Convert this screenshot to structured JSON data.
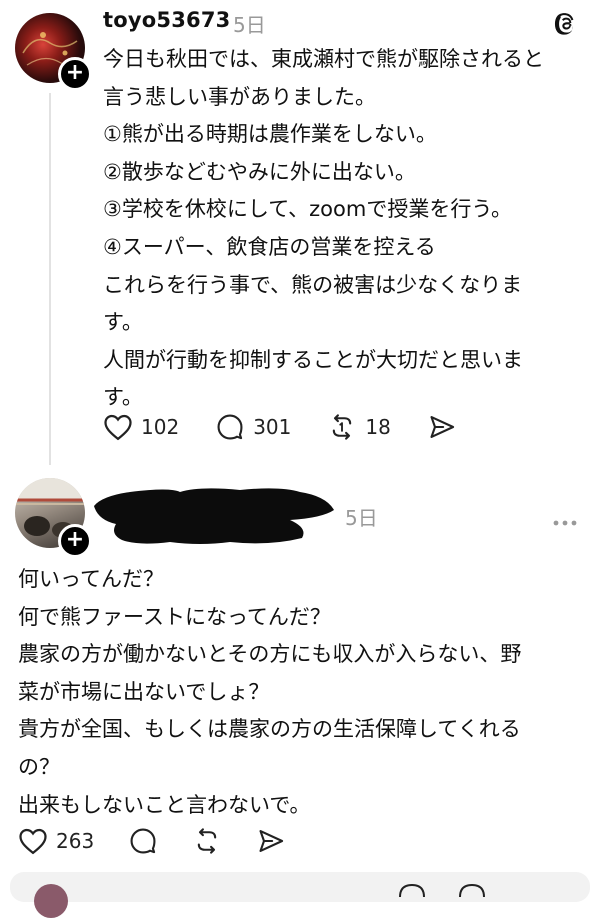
{
  "post1": {
    "username": "toyo53673",
    "time": "5日",
    "body": "今日も秋田では、東成瀬村で熊が駆除されると\n言う悲しい事がありました。\n①熊が出る時期は農作業をしない。\n②散歩などむやみに外に出ない。\n③学校を休校にして、zoomで授業を行う。\n④スーパー、飲食店の営業を控える\nこれらを行う事で、熊の被害は少なくなりま\nす。\n人間が行動を抑制することが大切だと思いま\nす。",
    "likes": "102",
    "replies": "301",
    "reposts": "18"
  },
  "post2": {
    "time": "5日",
    "body": "何いってんだ？\n何で熊ファーストになってんだ？\n農家の方が働かないとその方にも収入が入らない、野\n菜が市場に出ないでしょ？\n貴方が全国、もしくは農家の方の生活保障してくれる\nの？\n出来もしないこと言わないで。",
    "likes": "263"
  },
  "icons": {
    "threads": "threads-logo-icon",
    "like": "heart-icon",
    "reply": "comment-icon",
    "repost": "repost-icon",
    "share": "share-icon",
    "more": "more-icon",
    "follow": "plus-icon"
  }
}
